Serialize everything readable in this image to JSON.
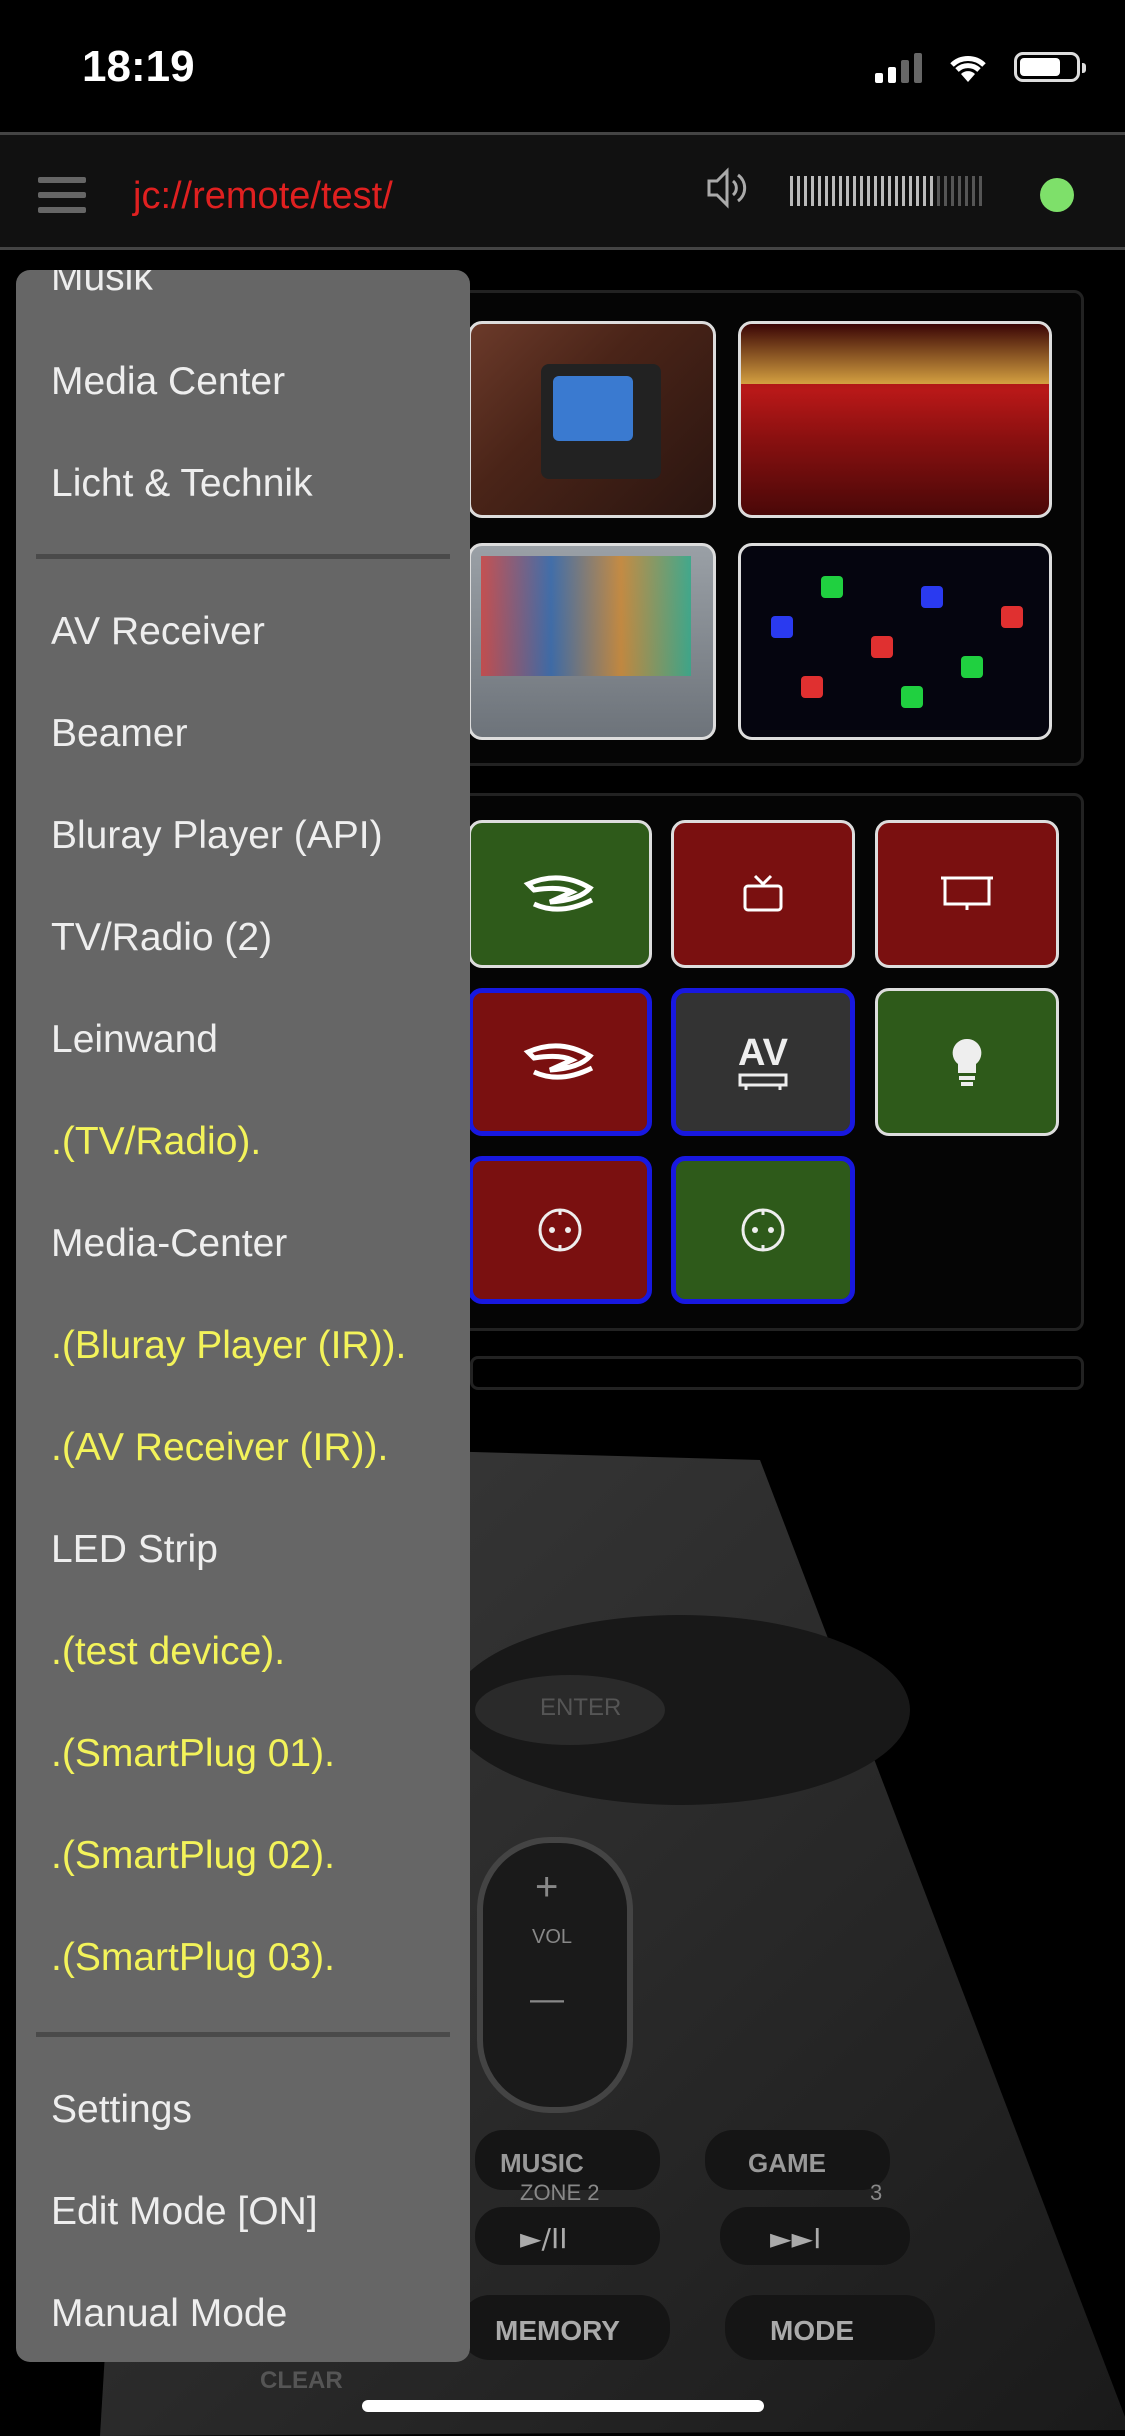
{
  "status_bar": {
    "time": "18:19"
  },
  "header": {
    "title": "jc://remote/test/",
    "volume_level": 0.75,
    "connection_status_color": "#7ee06a"
  },
  "drawer": {
    "groups": [
      "Musik",
      "Media Center",
      "Licht & Technik"
    ],
    "devices": [
      {
        "label": "AV Receiver",
        "virtual": false
      },
      {
        "label": "Beamer",
        "virtual": false
      },
      {
        "label": "Bluray Player (API)",
        "virtual": false
      },
      {
        "label": "TV/Radio (2)",
        "virtual": false
      },
      {
        "label": "Leinwand",
        "virtual": false
      },
      {
        "label": ".(TV/Radio).",
        "virtual": true
      },
      {
        "label": "Media-Center",
        "virtual": false
      },
      {
        "label": ".(Bluray Player (IR)).",
        "virtual": true
      },
      {
        "label": ".(AV Receiver (IR)).",
        "virtual": true
      },
      {
        "label": "LED Strip",
        "virtual": false
      },
      {
        "label": ".(test device).",
        "virtual": true
      },
      {
        "label": ".(SmartPlug 01).",
        "virtual": true
      },
      {
        "label": ".(SmartPlug 02).",
        "virtual": true
      },
      {
        "label": ".(SmartPlug 03).",
        "virtual": true
      }
    ],
    "footer": [
      "Settings",
      "Edit Mode [ON]",
      "Manual Mode"
    ]
  },
  "buttons": {
    "av_label": "AV"
  },
  "remote_photo": {
    "music": "MUSIC",
    "game": "GAME",
    "zone": "ZONE 2",
    "zone_num": "3",
    "play": "►/II",
    "skip": "►►I",
    "memory": "MEMORY",
    "mode": "MODE",
    "clear": "CLEAR",
    "enter": "ENTER",
    "vol": "VOL",
    "plus": "+",
    "minus": "—"
  },
  "colors": {
    "title_red": "#e02020",
    "virtual_yellow": "#f3f35a",
    "drawer_bg": "#666666",
    "button_green": "#2e5a1a",
    "button_red": "#7a1010",
    "selected_blue": "#1818e0"
  }
}
